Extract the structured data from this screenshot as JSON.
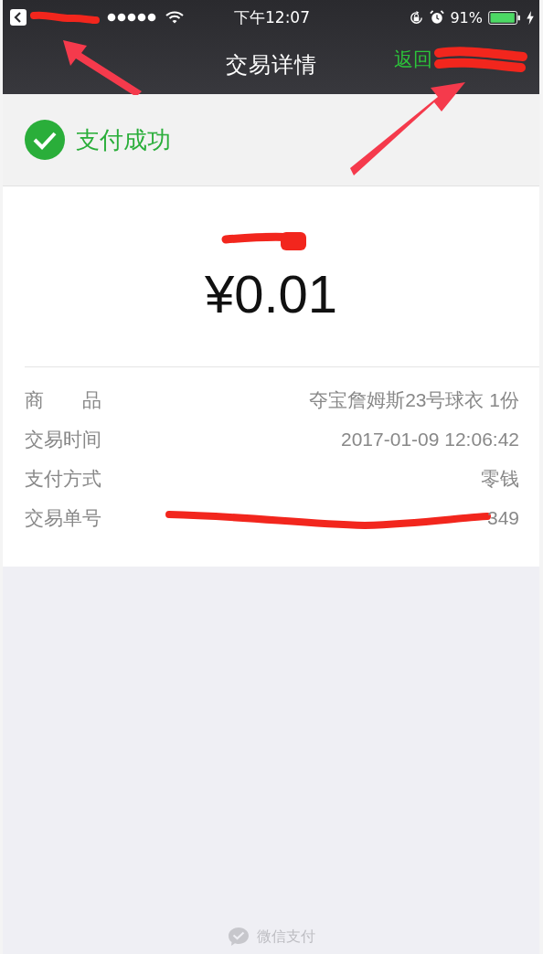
{
  "status_bar": {
    "time": "下午12:07",
    "battery": "91%"
  },
  "nav_bar": {
    "title": "交易详情",
    "back_link": "返回"
  },
  "result": {
    "status": "支付成功",
    "success": true
  },
  "amount": "¥0.01",
  "details": [
    {
      "label": "商　　品",
      "value": "夺宝詹姆斯23号球衣 1份"
    },
    {
      "label": "交易时间",
      "value": "2017-01-09 12:06:42"
    },
    {
      "label": "支付方式",
      "value": "零钱"
    },
    {
      "label": "交易单号",
      "value": "349"
    }
  ],
  "footer": "微信支付"
}
